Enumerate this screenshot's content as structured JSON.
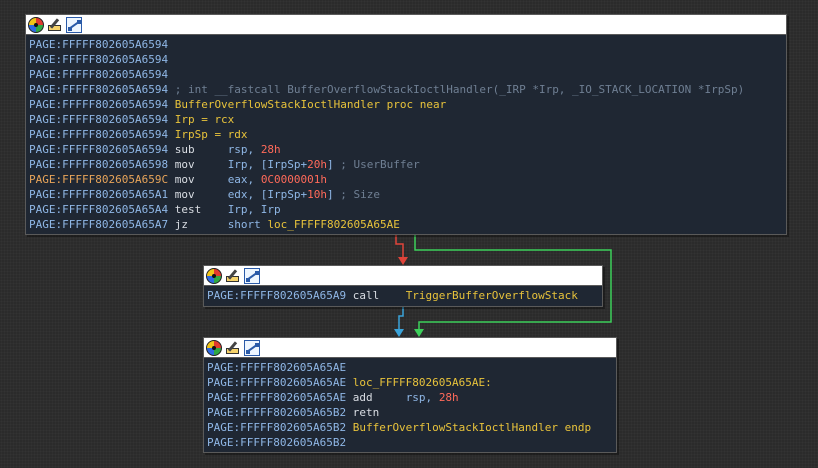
{
  "colors": {
    "edge_false": "#e0443a",
    "edge_true": "#3ccf5a",
    "edge_uncond": "#3aa3d9",
    "addr": "#8fb7e6",
    "addr_highlight": "#e8a55a",
    "number": "#ff6a5a",
    "label": "#e8c33b",
    "comment": "#6f7f93"
  },
  "toolbar_icons": [
    "set-color-icon",
    "rename-icon",
    "graph-overview-icon"
  ],
  "nodes": [
    {
      "id": "block1",
      "lines": [
        {
          "addr": "PAGE:FFFFF802605A6594"
        },
        {
          "addr": "PAGE:FFFFF802605A6594"
        },
        {
          "addr": "PAGE:FFFFF802605A6594"
        },
        {
          "addr": "PAGE:FFFFF802605A6594",
          "comment": "; int __fastcall BufferOverflowStackIoctlHandler(_IRP *Irp, _IO_STACK_LOCATION *IrpSp)"
        },
        {
          "addr": "PAGE:FFFFF802605A6594",
          "label": "BufferOverflowStackIoctlHandler proc near"
        },
        {
          "addr": "PAGE:FFFFF802605A6594",
          "text": "Irp = rcx"
        },
        {
          "addr": "PAGE:FFFFF802605A6594",
          "text": "IrpSp = rdx"
        },
        {
          "addr": "PAGE:FFFFF802605A6594",
          "mnem": "sub",
          "op1": "rsp, ",
          "num": "28h"
        },
        {
          "addr": "PAGE:FFFFF802605A6598",
          "mnem": "mov",
          "op1": "Irp, [IrpSp+",
          "num": "20h",
          "op2": "]",
          "cmt": " ; UserBuffer"
        },
        {
          "addr": "PAGE:FFFFF802605A659C",
          "highlight": true,
          "mnem": "mov",
          "op1": "eax, ",
          "num": "0C0000001h"
        },
        {
          "addr": "PAGE:FFFFF802605A65A1",
          "mnem": "mov",
          "op1": "edx, [IrpSp+",
          "num": "10h",
          "op2": "]",
          "cmt": " ; Size"
        },
        {
          "addr": "PAGE:FFFFF802605A65A4",
          "mnem": "test",
          "op1": "Irp, Irp"
        },
        {
          "addr": "PAGE:FFFFF802605A65A7",
          "mnem": "jz",
          "op1": "short ",
          "lbl": "loc_FFFFF802605A65AE"
        }
      ]
    },
    {
      "id": "block2",
      "lines": [
        {
          "addr": "PAGE:FFFFF802605A65A9",
          "mnem": "call",
          "lbl": "TriggerBufferOverflowStack"
        }
      ]
    },
    {
      "id": "block3",
      "lines": [
        {
          "addr": "PAGE:FFFFF802605A65AE"
        },
        {
          "addr": "PAGE:FFFFF802605A65AE",
          "label": "loc_FFFFF802605A65AE:"
        },
        {
          "addr": "PAGE:FFFFF802605A65AE",
          "mnem": "add",
          "op1": "rsp, ",
          "num": "28h"
        },
        {
          "addr": "PAGE:FFFFF802605A65B2",
          "mnem": "retn"
        },
        {
          "addr": "PAGE:FFFFF802605A65B2",
          "label": "BufferOverflowStackIoctlHandler endp"
        },
        {
          "addr": "PAGE:FFFFF802605A65B2"
        }
      ]
    }
  ]
}
